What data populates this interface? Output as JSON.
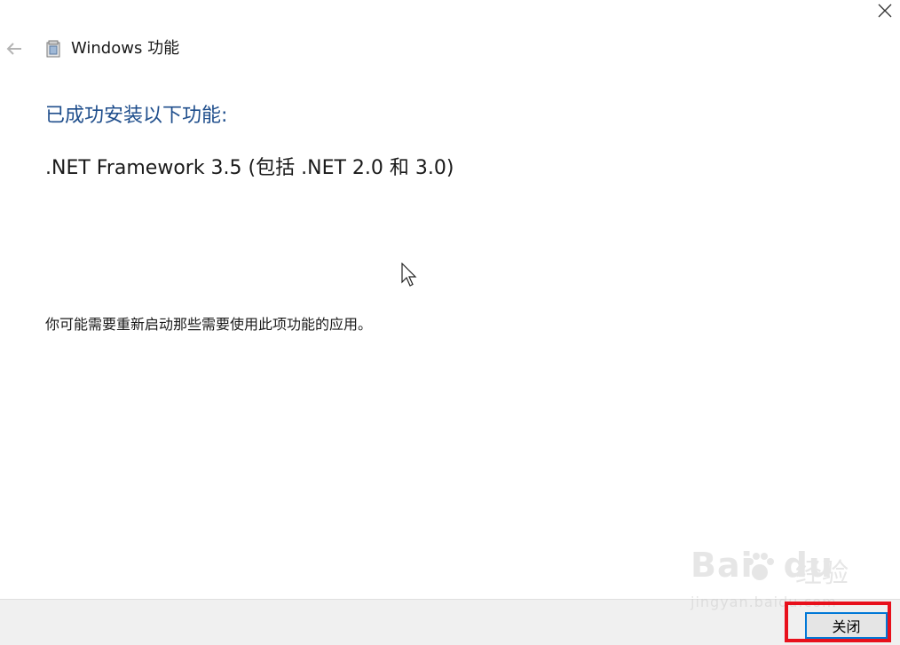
{
  "window": {
    "title": "Windows 功能",
    "close_icon": "close-icon",
    "back_icon": "back-arrow-icon",
    "app_icon": "windows-features-icon"
  },
  "content": {
    "heading": "已成功安装以下功能:",
    "feature": ".NET Framework 3.5 (包括 .NET 2.0 和 3.0)",
    "note": "你可能需要重新启动那些需要使用此项功能的应用。"
  },
  "footer": {
    "close_label": "关闭"
  },
  "watermark": {
    "brand_left": "Bai",
    "brand_right": "du",
    "cn": "经验",
    "url": "jingyan.baidu.com"
  },
  "colors": {
    "heading": "#1f4e8c",
    "button_border": "#0078d7",
    "highlight": "#e8101c",
    "footer_bg": "#f0f0f0"
  }
}
